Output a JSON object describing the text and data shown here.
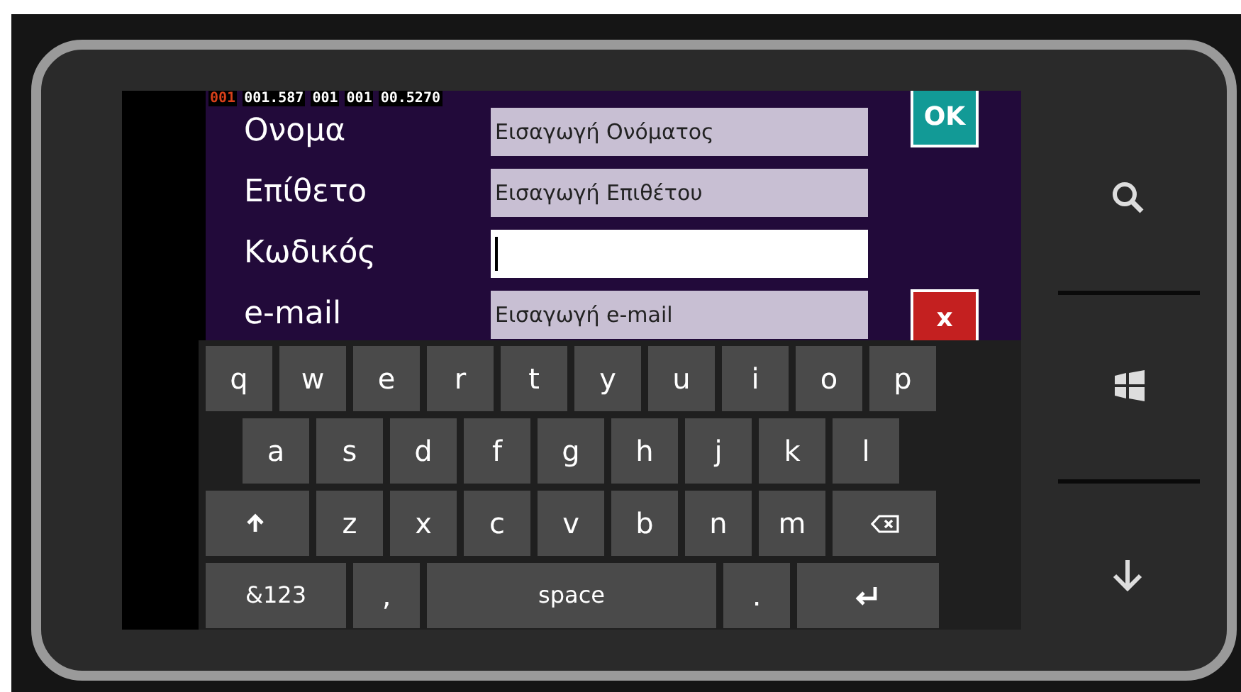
{
  "frame_counter": [
    {
      "text": "001",
      "kind": "alert"
    },
    {
      "text": "001.587",
      "kind": "normal"
    },
    {
      "text": "001",
      "kind": "normal"
    },
    {
      "text": "001",
      "kind": "normal"
    },
    {
      "text": "00.5270",
      "kind": "normal"
    }
  ],
  "form": {
    "rows": [
      {
        "label": "Ονομα",
        "value": "Εισαγωγή Ονόματος",
        "focused": false
      },
      {
        "label": "Επίθετο",
        "value": "Εισαγωγή Επιθέτου",
        "focused": false
      },
      {
        "label": "Κωδικός",
        "value": "",
        "focused": true
      },
      {
        "label": "e-mail",
        "value": "Εισαγωγή e-mail",
        "focused": false
      }
    ],
    "ok_button": "OK",
    "cancel_button": "x"
  },
  "keyboard": {
    "rows": [
      {
        "keys": [
          {
            "kind": "letter",
            "label": "q"
          },
          {
            "kind": "letter",
            "label": "w"
          },
          {
            "kind": "letter",
            "label": "e"
          },
          {
            "kind": "letter",
            "label": "r"
          },
          {
            "kind": "letter",
            "label": "t"
          },
          {
            "kind": "letter",
            "label": "y"
          },
          {
            "kind": "letter",
            "label": "u"
          },
          {
            "kind": "letter",
            "label": "i"
          },
          {
            "kind": "letter",
            "label": "o"
          },
          {
            "kind": "letter",
            "label": "p"
          }
        ]
      },
      {
        "keys": [
          {
            "kind": "letter",
            "label": "a"
          },
          {
            "kind": "letter",
            "label": "s"
          },
          {
            "kind": "letter",
            "label": "d"
          },
          {
            "kind": "letter",
            "label": "f"
          },
          {
            "kind": "letter",
            "label": "g"
          },
          {
            "kind": "letter",
            "label": "h"
          },
          {
            "kind": "letter",
            "label": "j"
          },
          {
            "kind": "letter",
            "label": "k"
          },
          {
            "kind": "letter",
            "label": "l"
          }
        ]
      },
      {
        "keys": [
          {
            "kind": "shift"
          },
          {
            "kind": "letter",
            "label": "z"
          },
          {
            "kind": "letter",
            "label": "x"
          },
          {
            "kind": "letter",
            "label": "c"
          },
          {
            "kind": "letter",
            "label": "v"
          },
          {
            "kind": "letter",
            "label": "b"
          },
          {
            "kind": "letter",
            "label": "n"
          },
          {
            "kind": "letter",
            "label": "m"
          },
          {
            "kind": "backspace"
          }
        ]
      },
      {
        "keys": [
          {
            "kind": "mode",
            "label": "&123"
          },
          {
            "kind": "letter",
            "label": ","
          },
          {
            "kind": "space",
            "label": "space"
          },
          {
            "kind": "letter",
            "label": "."
          },
          {
            "kind": "enter"
          }
        ]
      }
    ]
  },
  "hardware_buttons": [
    {
      "kind": "search"
    },
    {
      "kind": "start"
    },
    {
      "kind": "back"
    }
  ]
}
